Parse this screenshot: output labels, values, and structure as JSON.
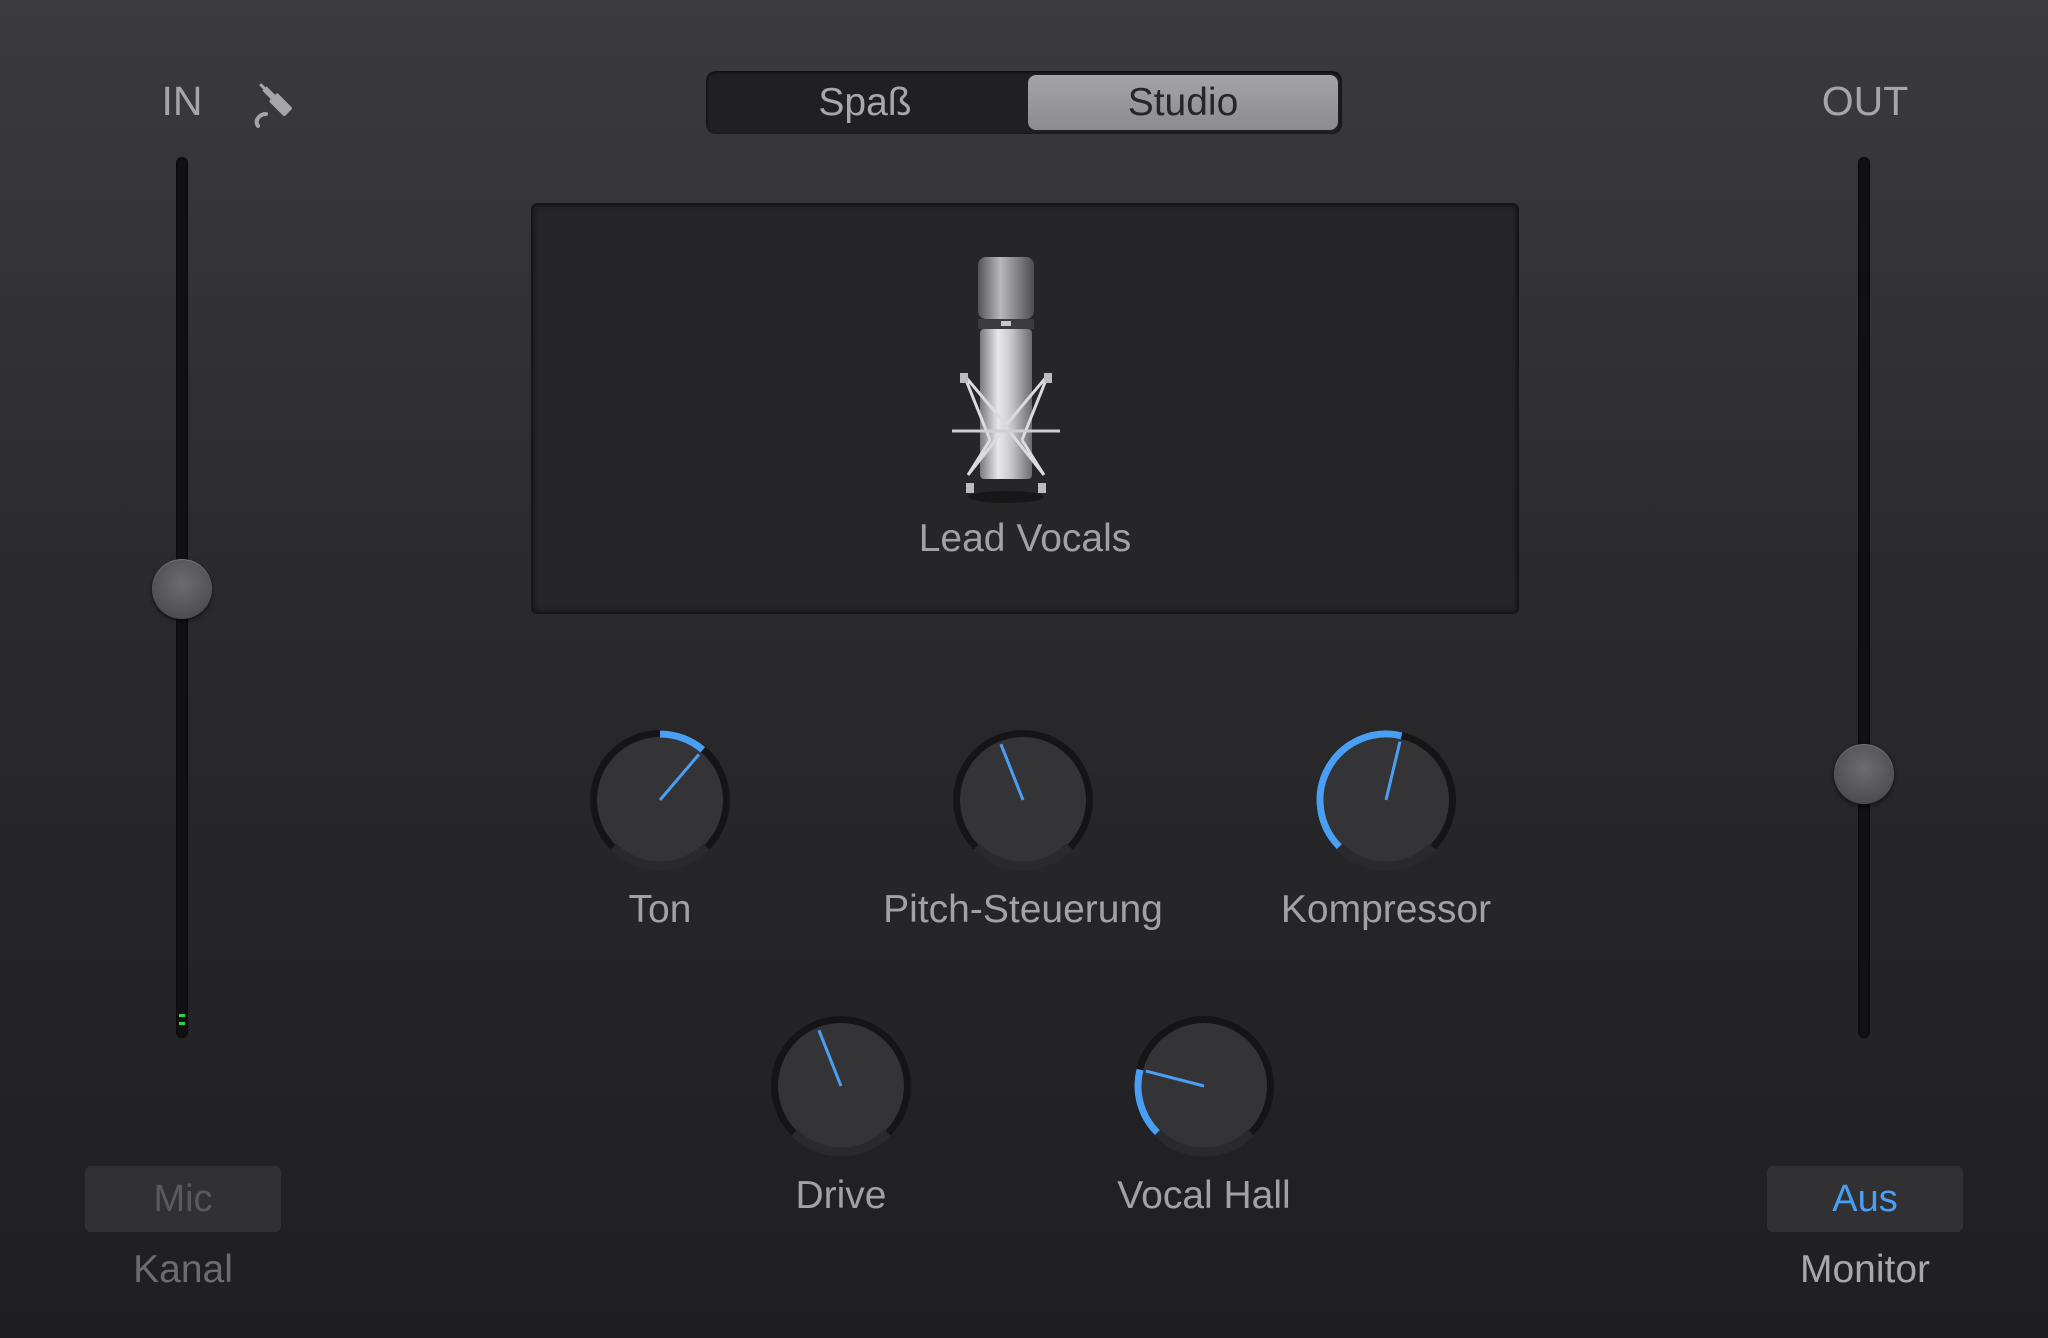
{
  "input": {
    "label": "IN",
    "icon": "cable-plug-icon",
    "level": 0.51
  },
  "output": {
    "label": "OUT",
    "level": 0.3
  },
  "mode": {
    "options": [
      "Spaß",
      "Studio"
    ],
    "selected": "Studio"
  },
  "preset": {
    "name": "Lead Vocals",
    "icon": "studio-microphone-icon"
  },
  "knobs": [
    {
      "label": "Ton",
      "value": 0.65
    },
    {
      "label": "Pitch-Steuerung",
      "value": 0.42
    },
    {
      "label": "Kompressor",
      "value": 0.55
    },
    {
      "label": "Drive",
      "value": 0.42
    },
    {
      "label": "Vocal Hall",
      "value": 0.22
    }
  ],
  "channel": {
    "button": "Mic",
    "caption": "Kanal"
  },
  "monitor": {
    "button": "Aus",
    "caption": "Monitor"
  },
  "colors": {
    "accent": "#4a9ff5",
    "meter": "#2fd14a"
  }
}
